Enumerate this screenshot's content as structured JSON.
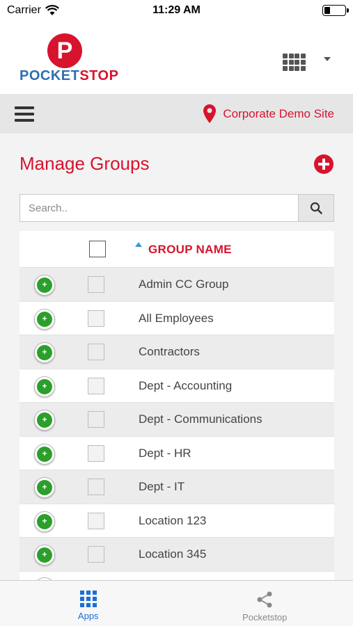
{
  "status_bar": {
    "carrier": "Carrier",
    "time": "11:29 AM"
  },
  "header": {
    "logo_letter": "P",
    "logo_text_part1": "POCKET",
    "logo_text_part2": "STOP",
    "apps_icon": "grid-icon",
    "dropdown_icon": "caret-down-icon"
  },
  "navbar": {
    "menu_icon": "hamburger-icon",
    "site_icon": "map-pin-icon",
    "site_name": "Corporate Demo Site"
  },
  "page": {
    "title": "Manage Groups",
    "add_icon": "plus-circle-icon"
  },
  "search": {
    "placeholder": "Search..",
    "value": ""
  },
  "table": {
    "column_header": "GROUP NAME",
    "sort": "ascending",
    "rows": [
      {
        "name": "Admin CC Group"
      },
      {
        "name": "All Employees"
      },
      {
        "name": "Contractors"
      },
      {
        "name": "Dept - Accounting"
      },
      {
        "name": "Dept - Communications"
      },
      {
        "name": "Dept - HR"
      },
      {
        "name": "Dept - IT"
      },
      {
        "name": "Location 123"
      },
      {
        "name": "Location 345"
      }
    ]
  },
  "tabbar": {
    "tabs": [
      {
        "label": "Apps",
        "icon": "apps-grid-icon",
        "active": true
      },
      {
        "label": "Pocketstop",
        "icon": "share-icon",
        "active": false
      }
    ]
  },
  "colors": {
    "brand_red": "#d7132e",
    "brand_blue": "#2e6db4",
    "active_tab": "#1a6fd9",
    "add_green": "#2aa02a"
  }
}
